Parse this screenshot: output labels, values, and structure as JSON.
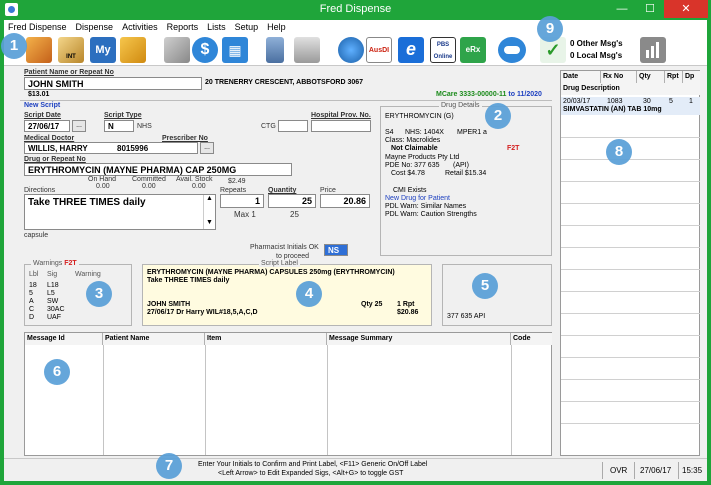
{
  "window": {
    "title": "Fred Dispense",
    "minimize": "—",
    "maximize": "☐",
    "close": "✕"
  },
  "menu": [
    "Fred Dispense",
    "Dispense",
    "Activities",
    "Reports",
    "Lists",
    "Setup",
    "Help"
  ],
  "toolbar": {
    "icons": [
      "dispense-icon",
      "int-icon",
      "my-icon",
      "package-icon",
      "edit-icon",
      "dollar-icon",
      "grid-icon",
      "clipboard-icon",
      "report-icon",
      "globe-network-icon",
      "ausdi-icon",
      "e-script-icon",
      "pbs-online-icon",
      "erx-icon",
      "pill-icon",
      "check-message-icon",
      "chart-icon"
    ],
    "int_label": "INT",
    "my_label": "My",
    "ausdi_label": "AusDI",
    "e_label": "e",
    "pbs_label": "PBS Online",
    "erx_label": "eRx",
    "other_msgs": "0 Other Msg's",
    "local_msgs": "0 Local Msg's"
  },
  "patient": {
    "label": "Patient Name or Repeat No",
    "name": "JOHN SMITH",
    "address": "20 TRENERRY CRESCENT, ABBOTSFORD 3067",
    "balance": "$13.01",
    "mcare": "MCare 3333-00000-11",
    "mcare_to": "to",
    "mcare_exp": "11/2020"
  },
  "script": {
    "heading": "New Script",
    "date_label": "Script Date",
    "date": "27/06/17",
    "type_label": "Script Type",
    "type": "N",
    "nhs": "NHS",
    "ctg_label": "CTG",
    "hosp_label": "Hospital Prov. No.",
    "doctor_label": "Medical Doctor",
    "prescriber_label": "Prescriber No",
    "doctor": "WILLIS, HARRY",
    "prescriber": "8015996",
    "browse": "...",
    "drug_label": "Drug or Repeat No",
    "drug": "ERYTHROMYCIN (MAYNE PHARMA) CAP 250MG",
    "on_hand_label": "On Hand",
    "on_hand": "0.00",
    "committed_label": "Committed",
    "committed": "0.00",
    "avail_label": "Avail. Stock",
    "avail": "$2.49",
    "avail_val": "0.00",
    "directions_label": "Directions",
    "directions": "Take THREE TIMES daily",
    "repeats_label": "Repeats",
    "repeats": "1",
    "max": "Max 1",
    "quantity_label": "Quantity",
    "quantity": "25",
    "quantity_sub": "25",
    "price_label": "Price",
    "price": "20.86",
    "form": "capsule",
    "pharm_init_label": "Pharmacist Initials OK",
    "pharm_init_label2": "to proceed",
    "pharm_init": "NS"
  },
  "drug_details": {
    "title": "Drug Details",
    "name": "ERYTHROMYCIN (G)",
    "s4": "S4",
    "nhs": "NHS: 1404X",
    "mper": "MPER1 a",
    "class": "Class: Macrolides",
    "claim": "Not Claimable",
    "f2t": "F2T",
    "mfr": "Mayne Products Pty Ltd",
    "pde": "PDE No:  377 635",
    "api": "(API)",
    "cost": "Cost  $4.78",
    "retail": "Retail  $15.34",
    "cmi": "CMI Exists",
    "new_drug": "New Drug for Patient",
    "pdl1": "PDL Warn: Similar Names",
    "pdl2": "PDL Warn: Caution Strengths"
  },
  "warnings": {
    "title": "Warnings",
    "f2t": "F2T",
    "h_lbl": "Lbl",
    "h_sig": "Sig",
    "h_warn": "Warning",
    "rows": [
      [
        "18",
        "L18"
      ],
      [
        "5",
        "L5"
      ],
      [
        "A",
        "SW"
      ],
      [
        "C",
        "30AC"
      ],
      [
        "D",
        "UAF"
      ]
    ]
  },
  "label_preview": {
    "title": "Script Label",
    "line1": "ERYTHROMYCIN (MAYNE PHARMA) CAPSULES 250mg (ERYTHROMYCIN)",
    "line2": "Take THREE TIMES daily",
    "patient": "JOHN SMITH",
    "qty": "Qty 25",
    "rpt": "1  Rpt",
    "date_dr": "27/06/17   Dr Harry WIL#18,5,A,C,D",
    "price": "$20.86"
  },
  "pde_box": {
    "text": "377 635  API"
  },
  "history": {
    "headers": [
      "Date",
      "Rx No",
      "Qty",
      "Rpt",
      "Dp"
    ],
    "sub_header": "Drug Description",
    "row": {
      "date": "20/03/17",
      "rx": "1083",
      "qty": "30",
      "rpt": "5",
      "dp": "1",
      "desc": "SIMVASTATIN (AN) TAB 10mg"
    }
  },
  "messages": {
    "headers": [
      "Message Id",
      "Patient Name",
      "Item",
      "Message Summary",
      "Code"
    ]
  },
  "status": {
    "line1": "Enter Your Initials to Confirm and Print Label, <F11> Generic On/Off Label",
    "line2": "<Left Arrow> to Edit Expanded Sigs, <Alt+G> to toggle GST",
    "ovr": "OVR",
    "date": "27/06/17",
    "time": "15:35"
  },
  "callouts": [
    "1",
    "2",
    "3",
    "4",
    "5",
    "6",
    "7",
    "8",
    "9"
  ],
  "colors": {
    "titlebar": "#1fa53a",
    "close": "#d9342a",
    "callout": "#5aa0d8",
    "label_bg": "#fffbe0"
  }
}
